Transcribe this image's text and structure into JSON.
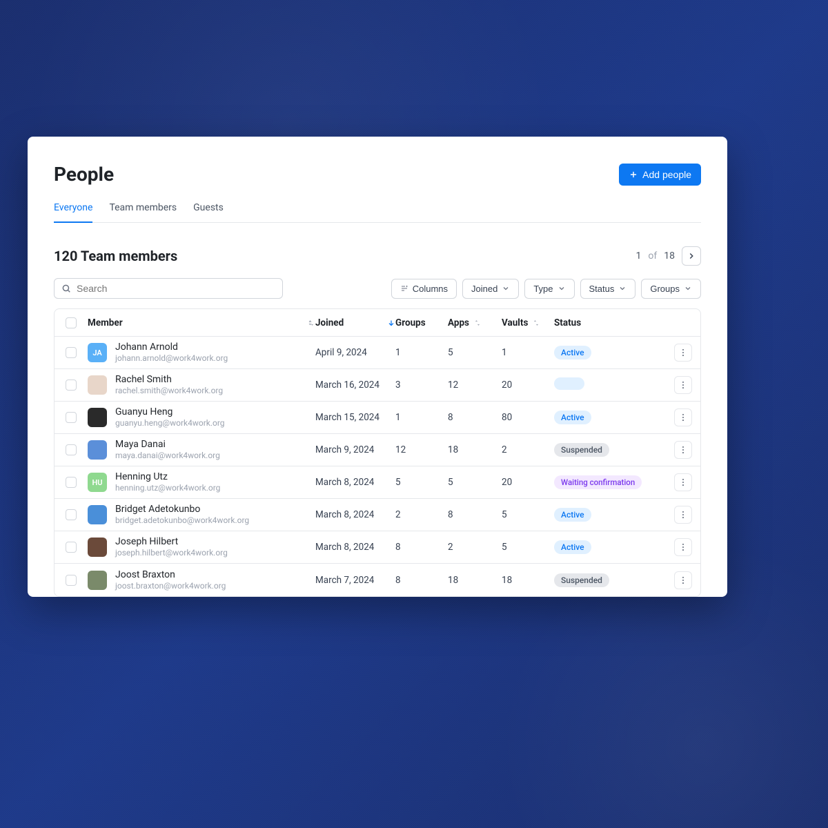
{
  "page": {
    "title": "People"
  },
  "actions": {
    "add_people": "Add people"
  },
  "tabs": [
    {
      "label": "Everyone",
      "active": true
    },
    {
      "label": "Team members",
      "active": false
    },
    {
      "label": "Guests",
      "active": false
    }
  ],
  "count_title": "120 Team members",
  "pagination": {
    "current": "1",
    "of_label": "of",
    "total": "18"
  },
  "search": {
    "placeholder": "Search"
  },
  "filters": {
    "columns": "Columns",
    "joined": "Joined",
    "type": "Type",
    "status": "Status",
    "groups": "Groups"
  },
  "columns": {
    "member": "Member",
    "joined": "Joined",
    "groups": "Groups",
    "apps": "Apps",
    "vaults": "Vaults",
    "status": "Status"
  },
  "status_labels": {
    "active": "Active",
    "suspended": "Suspended",
    "waiting": "Waiting confirmation"
  },
  "members": [
    {
      "name": "Johann Arnold",
      "email": "johann.arnold@work4work.org",
      "joined": "April 9, 2024",
      "groups": "1",
      "apps": "5",
      "vaults": "1",
      "status": "active",
      "avatar": {
        "initials": "JA",
        "bg": "#5ab0f7"
      }
    },
    {
      "name": "Rachel Smith",
      "email": "rachel.smith@work4work.org",
      "joined": "March 16, 2024",
      "groups": "3",
      "apps": "12",
      "vaults": "20",
      "status": "blank",
      "avatar": {
        "bg": "#e8d6c9"
      }
    },
    {
      "name": "Guanyu Heng",
      "email": "guanyu.heng@work4work.org",
      "joined": "March 15, 2024",
      "groups": "1",
      "apps": "8",
      "vaults": "80",
      "status": "active",
      "avatar": {
        "bg": "#2a2a2a"
      }
    },
    {
      "name": "Maya Danai",
      "email": "maya.danai@work4work.org",
      "joined": "March 9, 2024",
      "groups": "12",
      "apps": "18",
      "vaults": "2",
      "status": "suspended",
      "avatar": {
        "bg": "#5b8fd9"
      }
    },
    {
      "name": "Henning Utz",
      "email": "henning.utz@work4work.org",
      "joined": "March 8, 2024",
      "groups": "5",
      "apps": "5",
      "vaults": "20",
      "status": "waiting",
      "avatar": {
        "initials": "HU",
        "bg": "#8fd98f"
      }
    },
    {
      "name": "Bridget Adetokunbo",
      "email": "bridget.adetokunbo@work4work.org",
      "joined": "March 8, 2024",
      "groups": "2",
      "apps": "8",
      "vaults": "5",
      "status": "active",
      "avatar": {
        "bg": "#4a8fd9"
      }
    },
    {
      "name": "Joseph Hilbert",
      "email": "joseph.hilbert@work4work.org",
      "joined": "March 8, 2024",
      "groups": "8",
      "apps": "2",
      "vaults": "5",
      "status": "active",
      "avatar": {
        "bg": "#6b4a3a"
      }
    },
    {
      "name": "Joost Braxton",
      "email": "joost.braxton@work4work.org",
      "joined": "March 7, 2024",
      "groups": "8",
      "apps": "18",
      "vaults": "18",
      "status": "suspended",
      "avatar": {
        "bg": "#7a8a6a"
      }
    }
  ]
}
